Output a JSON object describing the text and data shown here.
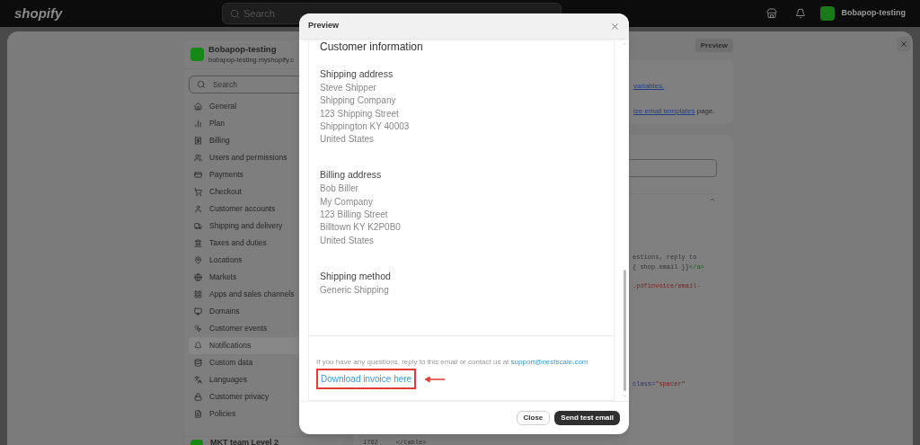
{
  "topbar": {
    "brand": "shopify",
    "search": {
      "placeholder": "Search"
    },
    "store_name": "Bobapop-testing"
  },
  "sidebar": {
    "store_name": "Bobapop-testing",
    "store_url": "bobapop-testing.myshopify.c",
    "search": {
      "placeholder": "Search"
    },
    "items": [
      {
        "label": "General",
        "selected": false
      },
      {
        "label": "Plan",
        "selected": false
      },
      {
        "label": "Billing",
        "selected": false
      },
      {
        "label": "Users and permissions",
        "selected": false
      },
      {
        "label": "Payments",
        "selected": false
      },
      {
        "label": "Checkout",
        "selected": false
      },
      {
        "label": "Customer accounts",
        "selected": false
      },
      {
        "label": "Shipping and delivery",
        "selected": false
      },
      {
        "label": "Taxes and duties",
        "selected": false
      },
      {
        "label": "Locations",
        "selected": false
      },
      {
        "label": "Markets",
        "selected": false
      },
      {
        "label": "Apps and sales channels",
        "selected": false
      },
      {
        "label": "Domains",
        "selected": false
      },
      {
        "label": "Customer events",
        "selected": false
      },
      {
        "label": "Notifications",
        "selected": true
      },
      {
        "label": "Custom data",
        "selected": false
      },
      {
        "label": "Languages",
        "selected": false
      },
      {
        "label": "Customer privacy",
        "selected": false
      },
      {
        "label": "Policies",
        "selected": false
      }
    ],
    "footer_store": "MKT team Level 2"
  },
  "page": {
    "preview_button": "Preview",
    "info_card": {
      "link_1": "variables.",
      "link_2": "ize email templates",
      "text_2": "page."
    },
    "code_lines": [
      {
        "kind": "plain",
        "text": "estions, reply to"
      },
      {
        "kind": "tag",
        "text": "{ shop.email }}",
        "tag": "</a>"
      },
      {
        "kind": "string",
        "text": ".pdfinvoice/email-"
      },
      {
        "kind": "attr",
        "text": "class=",
        "value": "\"spacer\""
      }
    ],
    "last_line": {
      "number": "1762",
      "text": "</table>"
    }
  },
  "modal": {
    "title": "Preview",
    "heading": "Customer information",
    "sections": [
      {
        "title": "Shipping address",
        "lines": [
          "Steve Shipper",
          "Shipping Company",
          "123 Shipping Street",
          "Shippington KY 40003",
          "United States"
        ]
      },
      {
        "title": "Billing address",
        "lines": [
          "Bob Biller",
          "My Company",
          "123 Billing Street",
          "Billtown KY K2P0B0",
          "United States"
        ]
      },
      {
        "title": "Shipping method",
        "lines": [
          "Generic Shipping"
        ]
      }
    ],
    "footer_text": "If you have any questions, reply to this email or contact us at",
    "support_email": "support@nestscale.com",
    "download_link": {
      "label": "Download invoice here",
      "highlighted": true
    },
    "buttons": [
      {
        "label": "Close",
        "kind": "secondary"
      },
      {
        "label": "Send test email",
        "kind": "primary"
      }
    ]
  }
}
